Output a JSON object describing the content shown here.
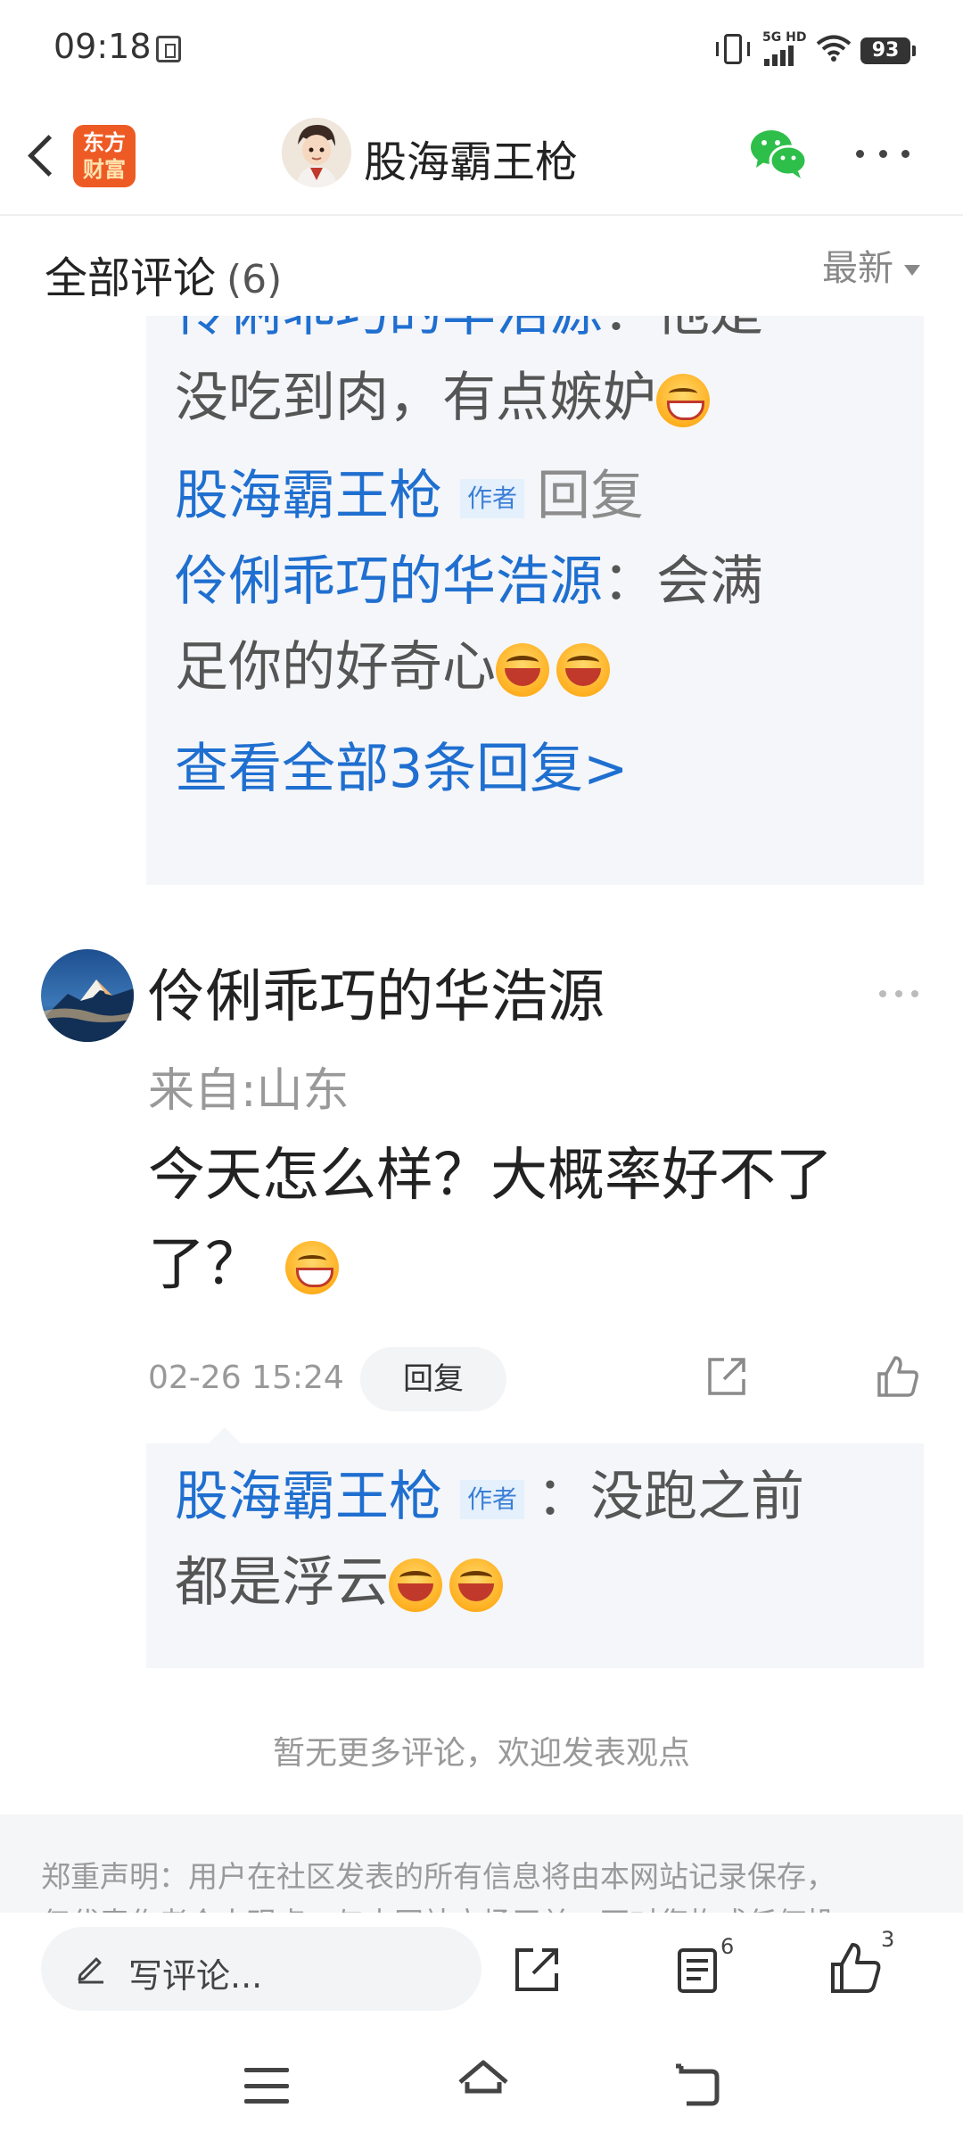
{
  "status_bar": {
    "time": "09:18",
    "network": "5G HD",
    "battery": "93"
  },
  "header": {
    "logo_line1": "东方",
    "logo_line2": "财富",
    "title": "股海霸王枪",
    "icons": [
      "back-icon",
      "wechat-icon",
      "more-icon"
    ]
  },
  "comments_bar": {
    "title": "全部评论",
    "count": "(6)",
    "sort": "最新"
  },
  "thread_top": {
    "line1_user": "伶俐乖巧的华浩源",
    "line1_text": "：他是",
    "line2_text": "没吃到肉，有点嫉妒",
    "author_name": "股海霸王枪",
    "author_tag": "作者",
    "reply_word": "回复",
    "reply_target": "伶俐乖巧的华浩源",
    "reply_text_a": "：会满",
    "reply_text_b": "足你的好奇心",
    "view_all": "查看全部3条回复>"
  },
  "comment": {
    "name": "伶俐乖巧的华浩源",
    "location": "来自:山东",
    "text": "今天怎么样？大概率好不了了？",
    "timestamp": "02-26 15:24",
    "reply_button": "回复"
  },
  "comment_reply": {
    "author_name": "股海霸王枪",
    "author_tag": "作者",
    "text_a": "：没跑之前",
    "text_b": "都是浮云"
  },
  "footer": {
    "no_more": "暂无更多评论，欢迎发表观点",
    "disclaimer_line1": "郑重声明：用户在社区发表的所有信息将由本网站记录保存，",
    "disclaimer_line2": "仅代表作者个人观点，与本网站立场无关，不对您构成任何投"
  },
  "bottom_bar": {
    "placeholder": "写评论...",
    "comment_count": "6",
    "like_count": "3"
  },
  "colors": {
    "link_blue": "#1f6fd0",
    "reply_bg": "#f5f6f9",
    "logo_orange": "#ee5a24"
  }
}
